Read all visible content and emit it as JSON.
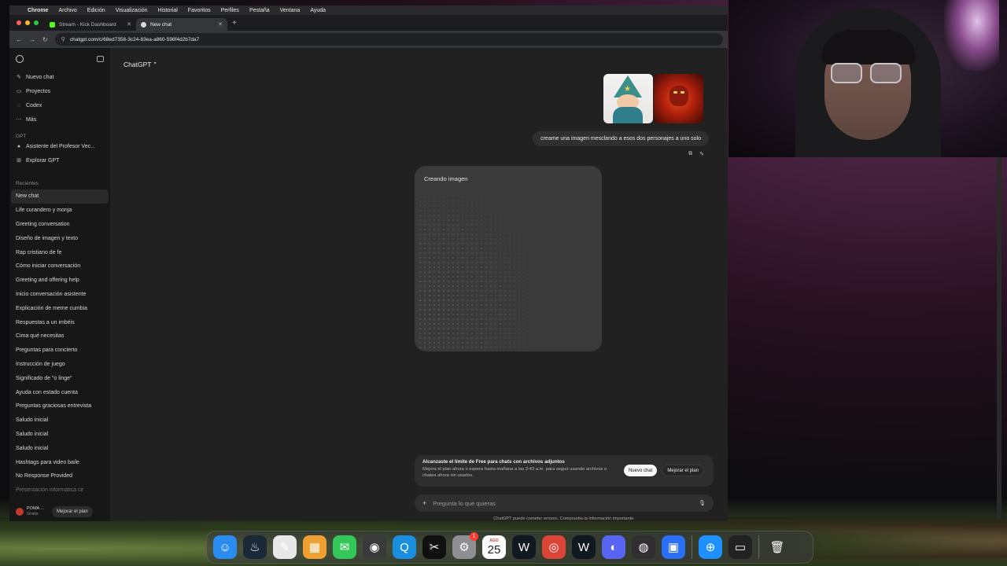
{
  "menubar": {
    "app": "Chrome",
    "items": [
      "Archivo",
      "Edición",
      "Visualización",
      "Historial",
      "Favoritos",
      "Perfiles",
      "Pestaña",
      "Ventana",
      "Ayuda"
    ]
  },
  "tabs": [
    {
      "title": "Stream - Kick Dashboard",
      "icon": "kick-icon",
      "color": "#53fc18"
    },
    {
      "title": "New chat",
      "icon": "chatgpt-icon",
      "color": "#d9d9d9"
    }
  ],
  "address": {
    "url": "chatgpt.com/c/68ed7358-3c24-83ea-a860-598f4d2b7da7"
  },
  "sidebar": {
    "nav": [
      {
        "label": "Nuevo chat",
        "icon": "compose-icon",
        "glyph": "✎"
      },
      {
        "label": "Proyectos",
        "icon": "folder-icon",
        "glyph": "▭"
      },
      {
        "label": "Codex",
        "icon": "codex-icon",
        "glyph": "◌"
      },
      {
        "label": "Más",
        "icon": "more-icon",
        "glyph": "⋯"
      }
    ],
    "gpt_header": "GPT",
    "gpts": [
      {
        "label": "Asistente del Profesor Vec...",
        "icon": "gpt-avatar-icon",
        "glyph": "●"
      },
      {
        "label": "Explorar GPT",
        "icon": "grid-icon",
        "glyph": "⊞"
      }
    ],
    "recent_header": "Recientes",
    "recents": [
      "New chat",
      "Life curandero y monja",
      "Greeting conversation",
      "Diseño de imagen y texto",
      "Rap cristiano de fe",
      "Cómo iniciar conversación",
      "Greeting and offering help",
      "Inicio conversación asistente",
      "Explicación de meme cumbia",
      "Respuestas a un imbéis",
      "Cima qué necesitas",
      "Preguntas para concierto",
      "Instrucción de juego",
      "Significado de \"o linge\"",
      "Ayuda con estado cuenta",
      "Preguntas graciosas entrevista",
      "Saludo inicial",
      "Saludo inicial",
      "Saludo inicial",
      "Hashtags para video baile",
      "No Response Provided",
      "Presentación informática cir"
    ],
    "user": {
      "name": "POMA ...",
      "plan": "Gratis",
      "upgrade": "Mejorar el plan"
    }
  },
  "main": {
    "model_label": "ChatGPT",
    "user_message": "creame una imagen mesclando a esos dos personajes a uno solo",
    "attachments": [
      {
        "name": "wizard-thumbnail"
      },
      {
        "name": "fire-demon-thumbnail"
      }
    ],
    "generating_label": "Creando imagen",
    "limit": {
      "heading": "Alcanzaste el límite de Free para chats con archivos adjuntos",
      "body": "Mejora el plan ahora o espera hasta mañana a las 2:43 a.m. para seguir usando archivos o chatea ahora sin usarlos.",
      "new_chat": "Nuevo chat",
      "upgrade": "Mejorar el plan"
    },
    "composer_placeholder": "Pregunta lo que quieras",
    "disclaimer": "ChatGPT puede cometer errores. Comprueba la información importante."
  },
  "dock": [
    {
      "name": "finder-icon",
      "glyph": "☺",
      "bg": "#2a8cf0"
    },
    {
      "name": "steam-icon",
      "glyph": "♨",
      "bg": "#1b2838"
    },
    {
      "name": "notes-icon",
      "glyph": "✎",
      "bg": "#e8e8e8"
    },
    {
      "name": "launchpad-icon",
      "glyph": "▦",
      "bg": "#f0a030"
    },
    {
      "name": "messages-icon",
      "glyph": "✉",
      "bg": "#34c759"
    },
    {
      "name": "screenshot-icon",
      "glyph": "◉",
      "bg": "#3a3a3c"
    },
    {
      "name": "quicktime-icon",
      "glyph": "Q",
      "bg": "#1a8fe0"
    },
    {
      "name": "capcut-icon",
      "glyph": "✂",
      "bg": "#101010"
    },
    {
      "name": "settings-icon",
      "glyph": "⚙",
      "bg": "#8e8e93",
      "badge": "1"
    },
    {
      "name": "calendar-icon",
      "month": "AGO",
      "day": "25"
    },
    {
      "name": "vnx-icon",
      "glyph": "W",
      "bg": "#101820"
    },
    {
      "name": "chrome-icon",
      "glyph": "◎",
      "bg": "#db4437"
    },
    {
      "name": "vnx-icon-2",
      "glyph": "W",
      "bg": "#101820"
    },
    {
      "name": "discord-icon",
      "glyph": "◐",
      "bg": "#5865f2"
    },
    {
      "name": "obs-icon",
      "glyph": "◍",
      "bg": "#302e31"
    },
    {
      "name": "roblox-studio-icon",
      "glyph": "▣",
      "bg": "#2a6ff5"
    },
    {
      "name": "safari-icon",
      "glyph": "⊕",
      "bg": "#1e90ff"
    },
    {
      "name": "stream-window-icon",
      "glyph": "▭",
      "bg": "#222"
    },
    {
      "name": "trash-icon",
      "glyph": "🗑",
      "bg": "transparent"
    }
  ]
}
